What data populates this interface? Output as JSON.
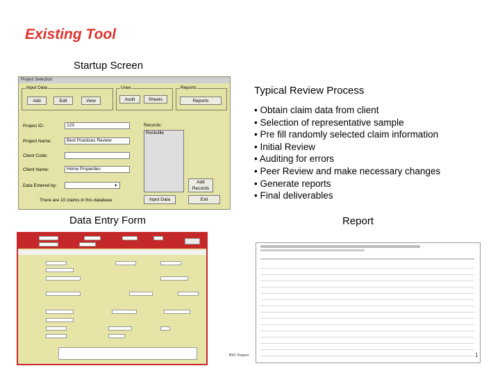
{
  "slide": {
    "title": "Existing Tool",
    "startup_caption": "Startup Screen",
    "review_heading": "Typical Review Process",
    "process_items": [
      "Obtain claim data from client",
      "Selection of representative sample",
      "Pre fill randomly selected claim information",
      "Initial Review",
      "Auditing for errors",
      "Peer Review and make necessary changes",
      "Generate reports",
      "Final deliverables"
    ],
    "data_entry_caption": "Data Entry Form",
    "report_caption": "Report",
    "footer_left": "BIO Towers",
    "page_number": "1"
  },
  "startup": {
    "window_title": "Project Selection",
    "groups": {
      "left": "Input Data",
      "middle": "Uses",
      "right": "Reports"
    },
    "buttons": {
      "add": "Add",
      "edit": "Edit",
      "view": "View",
      "audit": "Audit",
      "sheets": "Sheets",
      "reports": "Reports",
      "add_records": "Add Records",
      "input_data": "Input Data",
      "exit": "Exit"
    },
    "labels": {
      "project_id": "Project ID:",
      "project_name": "Project Name:",
      "client_code": "Client Code:",
      "client_name": "Client Name:",
      "data_entered_by": "Data Entered by:",
      "records": "Records:"
    },
    "values": {
      "project_id": "123",
      "project_name": "Best Practices Review",
      "client_code": "",
      "client_name": "Home Properties",
      "data_entered_by": "",
      "records_list": "Rockville"
    },
    "status_text": "There are 10 claims in this database"
  },
  "colors": {
    "title_red": "#e0322c",
    "form_yellow": "#e5e4a8",
    "entry_red": "#c42828"
  }
}
